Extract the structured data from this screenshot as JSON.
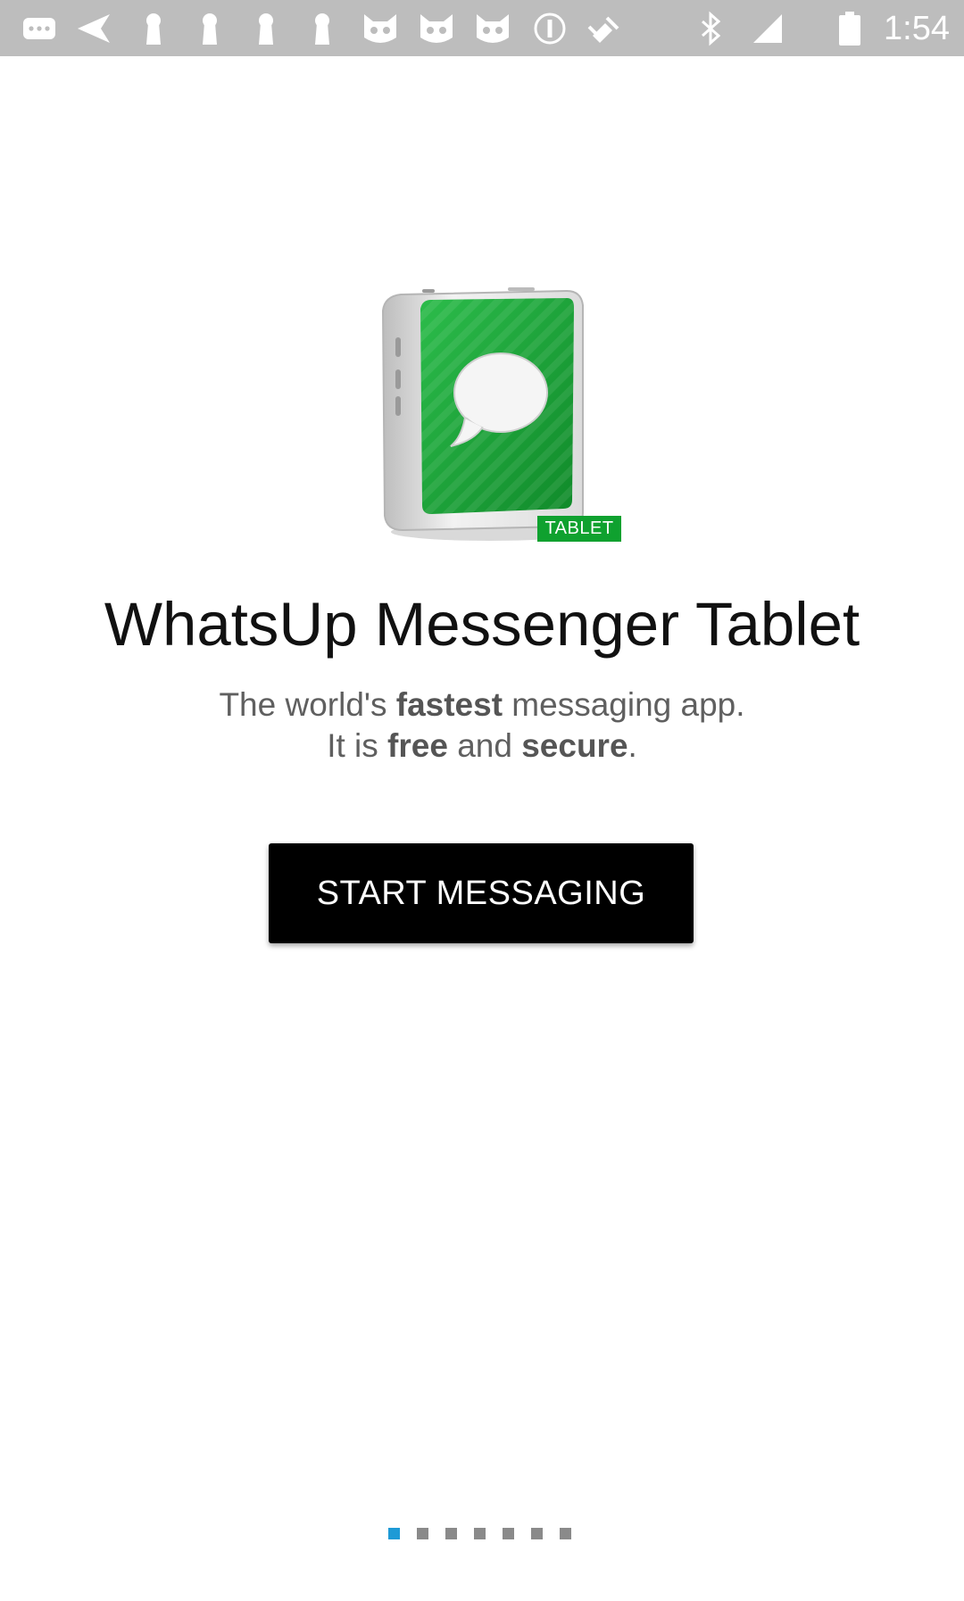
{
  "status_bar": {
    "time": "1:54",
    "icons": [
      "messages-icon",
      "send-icon",
      "keyhole-icon",
      "keyhole-icon",
      "keyhole-icon",
      "keyhole-icon",
      "cat-icon",
      "cat-icon",
      "cat-icon",
      "info-icon",
      "satellite-icon",
      "bluetooth-icon",
      "signal-icon",
      "battery-icon"
    ],
    "text_color": "#ffffff",
    "background": "#bdbdbd"
  },
  "logo": {
    "icon": "tablet-messenger-icon",
    "badge": "TABLET",
    "badge_color": "#0fa12f",
    "screen_color": "#1aa83a"
  },
  "app_title": "WhatsUp Messenger Tablet",
  "tagline": {
    "line1_prefix": "The world's ",
    "line1_bold": "fastest",
    "line1_suffix": " messaging app.",
    "line2_prefix": "It is ",
    "line2_bold1": "free",
    "line2_mid": " and ",
    "line2_bold2": "secure",
    "line2_suffix": "."
  },
  "start_button": {
    "label": "START MESSAGING",
    "background": "#000000"
  },
  "pager": {
    "count": 7,
    "active_index": 0,
    "active_color": "#1e9ad6",
    "inactive_color": "#8a8a8a"
  }
}
